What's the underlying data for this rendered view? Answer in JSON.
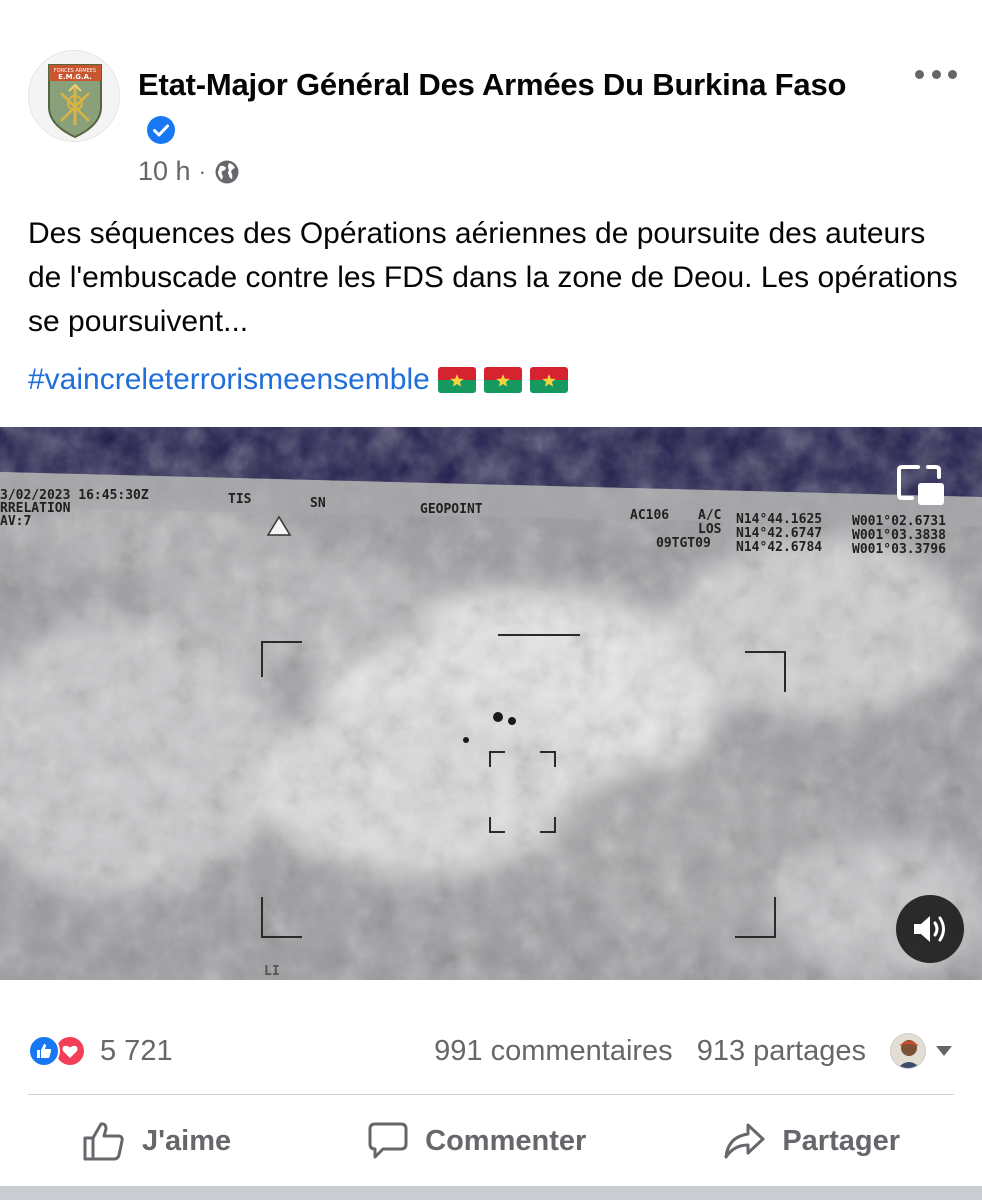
{
  "post": {
    "author": "Etat-Major Général Des Armées Du Burkina Faso",
    "verified": true,
    "time": "10 h",
    "audience_icon": "globe-icon",
    "avatar_text_top": "FORCES ARMEES",
    "avatar_text_main": "E.M.G.A.",
    "text": "Des séquences des Opérations aériennes de poursuite des auteurs de l'embuscade contre les FDS dans la zone de Deou. Les opérations se poursuivent...",
    "hashtag": "#vaincreleterrorismeensemble",
    "flags": [
      "burkina-faso-flag",
      "burkina-faso-flag",
      "burkina-faso-flag"
    ]
  },
  "video": {
    "hud_datetime": "3/02/2023 16:45:30Z",
    "hud_mode": "TIS",
    "hud_sn": "SN",
    "hud_correlation": "RRELATION",
    "hud_av": "AV:7",
    "hud_geopoint": "GEOPOINT",
    "hud_ac": "AC106",
    "hud_ac_mode": "A/C",
    "hud_ac_lat": "N14°44.1625",
    "hud_ac_lon": "W001°02.6731",
    "hud_los_label": "LOS",
    "hud_los_lat": "N14°42.6747",
    "hud_los_lon": "W001°03.3838",
    "hud_tgt_label": "09TGT09",
    "hud_tgt_lat": "N14°42.6784",
    "hud_tgt_lon": "W001°03.3796",
    "hud_bottom": "LI",
    "sound_state": "on"
  },
  "stats": {
    "reactions": [
      "like",
      "love"
    ],
    "reaction_count": "5 721",
    "comments": "991 commentaires",
    "shares": "913 partages"
  },
  "actions": {
    "like": "J'aime",
    "comment": "Commenter",
    "share": "Partager"
  },
  "colors": {
    "link": "#216fdb",
    "like": "#1877f2",
    "love": "#f33e58",
    "secondary_text": "#65676b"
  }
}
